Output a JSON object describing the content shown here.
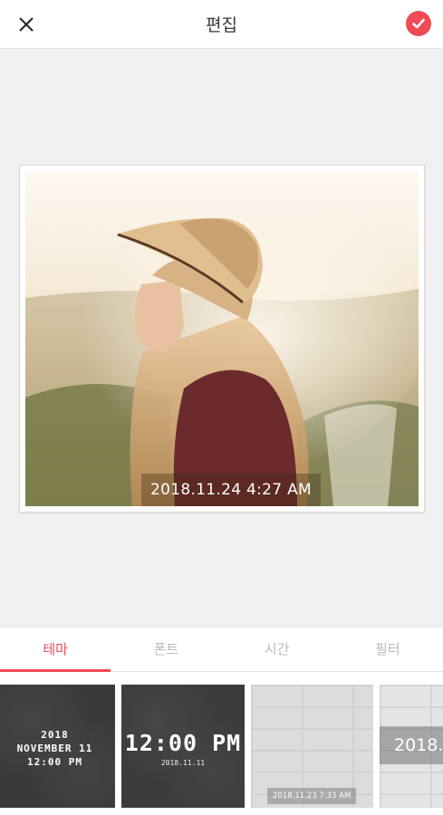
{
  "header": {
    "title": "편집",
    "close_icon": "close-icon",
    "confirm_icon": "check-circle-icon",
    "accent_color": "#ef4b55"
  },
  "photo": {
    "timestamp": "2018.11.24   4:27 AM"
  },
  "tabs": [
    {
      "label": "테마",
      "active": true
    },
    {
      "label": "폰트",
      "active": false
    },
    {
      "label": "시간",
      "active": false
    },
    {
      "label": "필터",
      "active": false
    }
  ],
  "themes": [
    {
      "lines": [
        "2018",
        "NOVEMBER 11",
        "12:00 PM"
      ]
    },
    {
      "time": "12:00 PM",
      "date": "2018.11.11"
    },
    {
      "stamp": "2018.11.23   7:33 AM"
    },
    {
      "text": "2018."
    }
  ]
}
